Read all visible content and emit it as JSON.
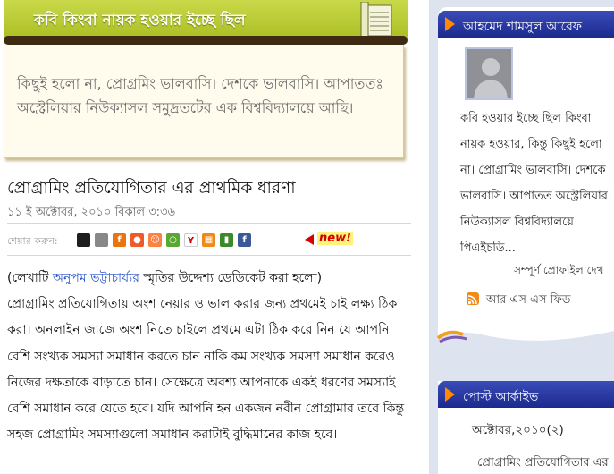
{
  "blog": {
    "title": "কবি কিংবা নায়ক হওয়ার ইচ্ছে ছিল",
    "description": "কিছুই হলো না, প্রোগ্রমিং ভালবাসি। দেশকে ভালবাসি। আপাততঃ অস্ট্রেলিয়ার নিউক্যাসল সমুদ্রতটের এক বিশ্ববিদ্যালয়ে আছি।"
  },
  "post": {
    "title": "প্রোগ্রামিং প্রতিযোগিতার এর প্রাথমিক ধারণা",
    "date": "১১ ই অক্টোবর, ২০১০ বিকাল ৩:৩৬",
    "share_label": "শেয়ার করুন:",
    "new_badge": "new!",
    "dedication_prefix": "(লেখাটি ",
    "dedication_author": "অনুপম ভট্টাচার্য্যর",
    "dedication_suffix": " স্মৃতির উদ্দেশ্য ডেডিকেট করা হলো)",
    "body": "প্রোগ্রামিং প্রতিযোগিতায় অংশ নেয়ার ও ভাল করার জন্য প্রথমেই চাই লক্ষ্য ঠিক করা। অনলাইন জাজে অংশ নিতে চাইলে প্রথমে এটা ঠিক করে নিন যে আপনি বেশি সংখ্যক সমস্যা সমাধান করতে চান নাকি কম সংখ্যক সমস্যা সমাধান করেও নিজের দক্ষতাকে বাড়াতে চান। সেক্ষেত্রে অবশ্য আপনাকে একই ধরণের সমস্যাই বেশি সমাধান করে যেতে হবে। যদি আপনি হন একজন নবীন প্রোগ্রামার তবে কিন্তু সহজ প্রোগ্রামিং সমস্যাগুলো সমাধান করাটাই বুদ্ধিমানের কাজ হবে।"
  },
  "share_icons": [
    {
      "name": "delicious-icon",
      "color": "#1e1e1e",
      "glyph": ""
    },
    {
      "name": "digg-icon",
      "color": "#888888",
      "glyph": ""
    },
    {
      "name": "friendfeed-icon",
      "color": "#e8730f",
      "glyph": "f"
    },
    {
      "name": "stumbleupon-icon",
      "color": "#f05a28",
      "glyph": "●"
    },
    {
      "name": "reddit-icon",
      "color": "#ff8040",
      "glyph": "☺"
    },
    {
      "name": "talk-icon",
      "color": "#5aa832",
      "glyph": "○"
    },
    {
      "name": "yahoo-icon",
      "color": "#ffffff",
      "glyph": "Y"
    },
    {
      "name": "grid-icon",
      "color": "#ef8a16",
      "glyph": "▦"
    },
    {
      "name": "bookmark-icon",
      "color": "#3a8a2a",
      "glyph": "▮"
    },
    {
      "name": "facebook-icon",
      "color": "#3b5998",
      "glyph": "f"
    }
  ],
  "sidebar": {
    "profile_header": "আহমেদ শামসুল আরেফ",
    "profile_text": "কবি হওয়ার ইচ্ছে ছিল কিংবা নায়ক হওয়ার, কিন্তু কিছুই হলো না। প্রোগ্রামিং ভালবাসি। দেশকে ভালবাসি। আপাতত অস্ট্রেলিয়ার নিউক্যাসল বিশ্ববিদ্যালয়ে পিএইচডি...",
    "full_profile_link": "সম্পূর্ণ প্রোফাইল দেখ",
    "rss_label": "আর এস এস ফিড",
    "archive_header": "পোস্ট আর্কাইভ",
    "archive_month": "অক্টোবর,২০১০(২)",
    "archive_post": "প্রোগ্রামিং প্রতিযোগিতার এর"
  },
  "colors": {
    "header_green": "#b5c82c",
    "sidebar_header_blue": "#22329a",
    "accent_orange": "#ff8a00",
    "link_blue": "#2a55c8"
  }
}
